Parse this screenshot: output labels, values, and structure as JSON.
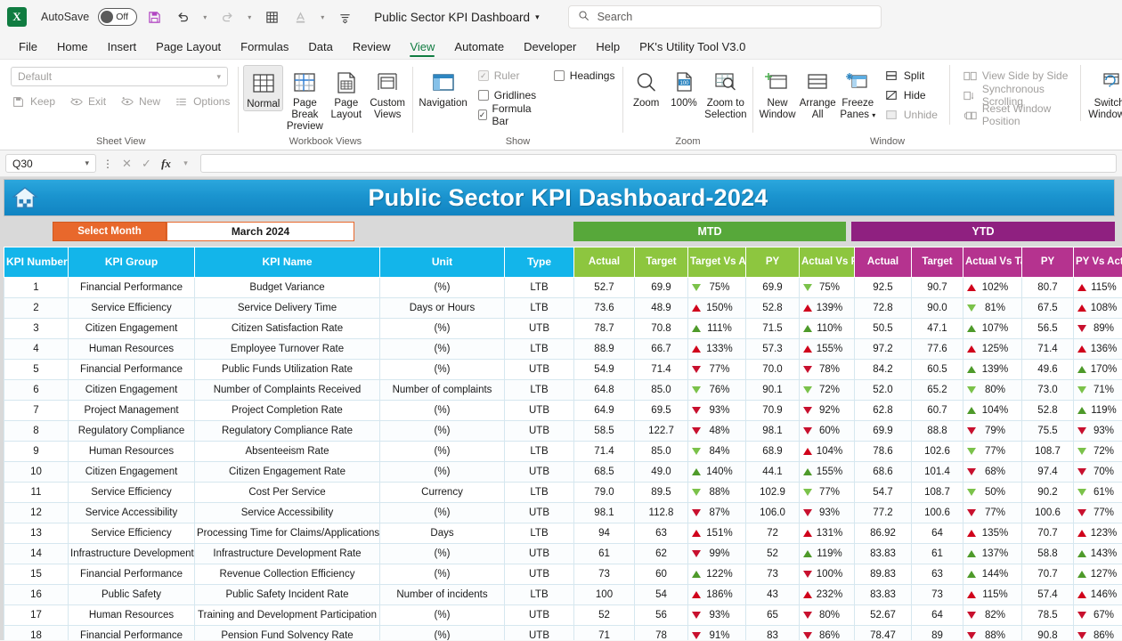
{
  "titlebar": {
    "autosave_label": "AutoSave",
    "autosave_state": "Off",
    "doc_title": "Public Sector KPI Dashboard",
    "search_placeholder": "Search",
    "xl_logo_letter": "X"
  },
  "tabs": [
    {
      "label": "File",
      "active": false
    },
    {
      "label": "Home",
      "active": false
    },
    {
      "label": "Insert",
      "active": false
    },
    {
      "label": "Page Layout",
      "active": false
    },
    {
      "label": "Formulas",
      "active": false
    },
    {
      "label": "Data",
      "active": false
    },
    {
      "label": "Review",
      "active": false
    },
    {
      "label": "View",
      "active": true
    },
    {
      "label": "Automate",
      "active": false
    },
    {
      "label": "Developer",
      "active": false
    },
    {
      "label": "Help",
      "active": false
    },
    {
      "label": "PK's Utility Tool V3.0",
      "active": false
    }
  ],
  "ribbon": {
    "groups": [
      {
        "name": "Sheet View",
        "combo_value": "Default",
        "buttons": [
          "Keep",
          "Exit",
          "New",
          "Options"
        ]
      },
      {
        "name": "Workbook Views",
        "buttons": [
          "Normal",
          "Page Break Preview",
          "Page Layout",
          "Custom Views"
        ]
      },
      {
        "name": "Show",
        "navigation": "Navigation",
        "checks": [
          {
            "label": "Ruler",
            "checked": true,
            "disabled": true
          },
          {
            "label": "Gridlines",
            "checked": false,
            "disabled": false
          },
          {
            "label": "Formula Bar",
            "checked": true,
            "disabled": false
          },
          {
            "label": "Headings",
            "checked": false,
            "disabled": false
          }
        ]
      },
      {
        "name": "Zoom",
        "buttons": [
          "Zoom",
          "100%",
          "Zoom to Selection"
        ]
      },
      {
        "name": "Window",
        "buttons": [
          "New Window",
          "Arrange All",
          "Freeze Panes"
        ],
        "small": [
          "Split",
          "Hide",
          "Unhide"
        ],
        "small2": [
          "View Side by Side",
          "Synchronous Scrolling",
          "Reset Window Position"
        ],
        "switch": "Switch Windows"
      }
    ]
  },
  "formula_bar": {
    "name_box": "Q30",
    "formula_value": "",
    "cancel_icon": "cancel-icon",
    "enter_icon": "enter-icon",
    "fx_icon": "fx-icon"
  },
  "dashboard": {
    "title": "Public Sector KPI Dashboard-2024",
    "home_icon": "home-icon",
    "select_month_label": "Select Month",
    "selected_month": "March 2024",
    "period_mtd": "MTD",
    "period_ytd": "YTD",
    "colors": {
      "banner": "#1b94cf",
      "select_month": "#e8682c",
      "mtd": "#57a83a",
      "mtd_header": "#8dc63f",
      "ytd": "#8f2080",
      "ytd_header": "#b5338f",
      "left_header": "#13b5ea",
      "up_red": "#d0021b",
      "down_red": "#c8102e",
      "up_green": "#4e9a2a",
      "down_green": "#7bc24a"
    },
    "columns_left": [
      "KPI Number",
      "KPI Group",
      "KPI Name",
      "Unit",
      "Type"
    ],
    "columns_mtd": [
      "Actual",
      "Target",
      "Target Vs Actual",
      "PY",
      "Actual Vs PY"
    ],
    "columns_ytd": [
      "Actual",
      "Target",
      "Actual Vs Target",
      "PY",
      "PY Vs Actual"
    ],
    "rows": [
      {
        "n": "1",
        "group": "Financial Performance",
        "name": "Budget Variance",
        "unit": "(%)",
        "type": "LTB",
        "mtd": {
          "actual": "52.7",
          "target": "69.9",
          "tva": "75%",
          "tva_dir": "down",
          "tva_color": "down_green",
          "py": "69.9",
          "avp": "75%",
          "avp_dir": "down",
          "avp_color": "down_green"
        },
        "ytd": {
          "actual": "92.5",
          "target": "90.7",
          "avt": "102%",
          "avt_dir": "up",
          "avt_color": "up_red",
          "py": "80.7",
          "pva": "115%",
          "pva_dir": "up",
          "pva_color": "up_red"
        }
      },
      {
        "n": "2",
        "group": "Service Efficiency",
        "name": "Service Delivery Time",
        "unit": "Days or Hours",
        "type": "LTB",
        "mtd": {
          "actual": "73.6",
          "target": "48.9",
          "tva": "150%",
          "tva_dir": "up",
          "tva_color": "up_red",
          "py": "52.8",
          "avp": "139%",
          "avp_dir": "up",
          "avp_color": "up_red"
        },
        "ytd": {
          "actual": "72.8",
          "target": "90.0",
          "avt": "81%",
          "avt_dir": "down",
          "avt_color": "down_green",
          "py": "67.5",
          "pva": "108%",
          "pva_dir": "up",
          "pva_color": "up_red"
        }
      },
      {
        "n": "3",
        "group": "Citizen Engagement",
        "name": "Citizen Satisfaction Rate",
        "unit": "(%)",
        "type": "UTB",
        "mtd": {
          "actual": "78.7",
          "target": "70.8",
          "tva": "111%",
          "tva_dir": "up",
          "tva_color": "up_green",
          "py": "71.5",
          "avp": "110%",
          "avp_dir": "up",
          "avp_color": "up_green"
        },
        "ytd": {
          "actual": "50.5",
          "target": "47.1",
          "avt": "107%",
          "avt_dir": "up",
          "avt_color": "up_green",
          "py": "56.5",
          "pva": "89%",
          "pva_dir": "down",
          "pva_color": "down_red"
        }
      },
      {
        "n": "4",
        "group": "Human Resources",
        "name": "Employee Turnover Rate",
        "unit": "(%)",
        "type": "LTB",
        "mtd": {
          "actual": "88.9",
          "target": "66.7",
          "tva": "133%",
          "tva_dir": "up",
          "tva_color": "up_red",
          "py": "57.3",
          "avp": "155%",
          "avp_dir": "up",
          "avp_color": "up_red"
        },
        "ytd": {
          "actual": "97.2",
          "target": "77.6",
          "avt": "125%",
          "avt_dir": "up",
          "avt_color": "up_red",
          "py": "71.4",
          "pva": "136%",
          "pva_dir": "up",
          "pva_color": "up_red"
        }
      },
      {
        "n": "5",
        "group": "Financial Performance",
        "name": "Public Funds Utilization Rate",
        "unit": "(%)",
        "type": "UTB",
        "mtd": {
          "actual": "54.9",
          "target": "71.4",
          "tva": "77%",
          "tva_dir": "down",
          "tva_color": "down_red",
          "py": "70.0",
          "avp": "78%",
          "avp_dir": "down",
          "avp_color": "down_red"
        },
        "ytd": {
          "actual": "84.2",
          "target": "60.5",
          "avt": "139%",
          "avt_dir": "up",
          "avt_color": "up_green",
          "py": "49.6",
          "pva": "170%",
          "pva_dir": "up",
          "pva_color": "up_green"
        }
      },
      {
        "n": "6",
        "group": "Citizen Engagement",
        "name": "Number of Complaints Received",
        "unit": "Number of complaints",
        "type": "LTB",
        "mtd": {
          "actual": "64.8",
          "target": "85.0",
          "tva": "76%",
          "tva_dir": "down",
          "tva_color": "down_green",
          "py": "90.1",
          "avp": "72%",
          "avp_dir": "down",
          "avp_color": "down_green"
        },
        "ytd": {
          "actual": "52.0",
          "target": "65.2",
          "avt": "80%",
          "avt_dir": "down",
          "avt_color": "down_green",
          "py": "73.0",
          "pva": "71%",
          "pva_dir": "down",
          "pva_color": "down_green"
        }
      },
      {
        "n": "7",
        "group": "Project Management",
        "name": "Project Completion Rate",
        "unit": "(%)",
        "type": "UTB",
        "mtd": {
          "actual": "64.9",
          "target": "69.5",
          "tva": "93%",
          "tva_dir": "down",
          "tva_color": "down_red",
          "py": "70.9",
          "avp": "92%",
          "avp_dir": "down",
          "avp_color": "down_red"
        },
        "ytd": {
          "actual": "62.8",
          "target": "60.7",
          "avt": "104%",
          "avt_dir": "up",
          "avt_color": "up_green",
          "py": "52.8",
          "pva": "119%",
          "pva_dir": "up",
          "pva_color": "up_green"
        }
      },
      {
        "n": "8",
        "group": "Regulatory Compliance",
        "name": "Regulatory Compliance Rate",
        "unit": "(%)",
        "type": "UTB",
        "mtd": {
          "actual": "58.5",
          "target": "122.7",
          "tva": "48%",
          "tva_dir": "down",
          "tva_color": "down_red",
          "py": "98.1",
          "avp": "60%",
          "avp_dir": "down",
          "avp_color": "down_red"
        },
        "ytd": {
          "actual": "69.9",
          "target": "88.8",
          "avt": "79%",
          "avt_dir": "down",
          "avt_color": "down_red",
          "py": "75.5",
          "pva": "93%",
          "pva_dir": "down",
          "pva_color": "down_red"
        }
      },
      {
        "n": "9",
        "group": "Human Resources",
        "name": "Absenteeism Rate",
        "unit": "(%)",
        "type": "LTB",
        "mtd": {
          "actual": "71.4",
          "target": "85.0",
          "tva": "84%",
          "tva_dir": "down",
          "tva_color": "down_green",
          "py": "68.9",
          "avp": "104%",
          "avp_dir": "up",
          "avp_color": "up_red"
        },
        "ytd": {
          "actual": "78.6",
          "target": "102.6",
          "avt": "77%",
          "avt_dir": "down",
          "avt_color": "down_green",
          "py": "108.7",
          "pva": "72%",
          "pva_dir": "down",
          "pva_color": "down_green"
        }
      },
      {
        "n": "10",
        "group": "Citizen Engagement",
        "name": "Citizen Engagement Rate",
        "unit": "(%)",
        "type": "UTB",
        "mtd": {
          "actual": "68.5",
          "target": "49.0",
          "tva": "140%",
          "tva_dir": "up",
          "tva_color": "up_green",
          "py": "44.1",
          "avp": "155%",
          "avp_dir": "up",
          "avp_color": "up_green"
        },
        "ytd": {
          "actual": "68.6",
          "target": "101.4",
          "avt": "68%",
          "avt_dir": "down",
          "avt_color": "down_red",
          "py": "97.4",
          "pva": "70%",
          "pva_dir": "down",
          "pva_color": "down_red"
        }
      },
      {
        "n": "11",
        "group": "Service Efficiency",
        "name": "Cost Per Service",
        "unit": "Currency",
        "type": "LTB",
        "mtd": {
          "actual": "79.0",
          "target": "89.5",
          "tva": "88%",
          "tva_dir": "down",
          "tva_color": "down_green",
          "py": "102.9",
          "avp": "77%",
          "avp_dir": "down",
          "avp_color": "down_green"
        },
        "ytd": {
          "actual": "54.7",
          "target": "108.7",
          "avt": "50%",
          "avt_dir": "down",
          "avt_color": "down_green",
          "py": "90.2",
          "pva": "61%",
          "pva_dir": "down",
          "pva_color": "down_green"
        }
      },
      {
        "n": "12",
        "group": "Service Accessibility",
        "name": "Service Accessibility",
        "unit": "(%)",
        "type": "UTB",
        "mtd": {
          "actual": "98.1",
          "target": "112.8",
          "tva": "87%",
          "tva_dir": "down",
          "tva_color": "down_red",
          "py": "106.0",
          "avp": "93%",
          "avp_dir": "down",
          "avp_color": "down_red"
        },
        "ytd": {
          "actual": "77.2",
          "target": "100.6",
          "avt": "77%",
          "avt_dir": "down",
          "avt_color": "down_red",
          "py": "100.6",
          "pva": "77%",
          "pva_dir": "down",
          "pva_color": "down_red"
        }
      },
      {
        "n": "13",
        "group": "Service Efficiency",
        "name": "Processing Time for Claims/Applications",
        "unit": "Days",
        "type": "LTB",
        "mtd": {
          "actual": "94",
          "target": "63",
          "tva": "151%",
          "tva_dir": "up",
          "tva_color": "up_red",
          "py": "72",
          "avp": "131%",
          "avp_dir": "up",
          "avp_color": "up_red"
        },
        "ytd": {
          "actual": "86.92",
          "target": "64",
          "avt": "135%",
          "avt_dir": "up",
          "avt_color": "up_red",
          "py": "70.7",
          "pva": "123%",
          "pva_dir": "up",
          "pva_color": "up_red"
        }
      },
      {
        "n": "14",
        "group": "Infrastructure Development",
        "name": "Infrastructure Development Rate",
        "unit": "(%)",
        "type": "UTB",
        "mtd": {
          "actual": "61",
          "target": "62",
          "tva": "99%",
          "tva_dir": "down",
          "tva_color": "down_red",
          "py": "52",
          "avp": "119%",
          "avp_dir": "up",
          "avp_color": "up_green"
        },
        "ytd": {
          "actual": "83.83",
          "target": "61",
          "avt": "137%",
          "avt_dir": "up",
          "avt_color": "up_green",
          "py": "58.8",
          "pva": "143%",
          "pva_dir": "up",
          "pva_color": "up_green"
        }
      },
      {
        "n": "15",
        "group": "Financial Performance",
        "name": "Revenue Collection Efficiency",
        "unit": "(%)",
        "type": "UTB",
        "mtd": {
          "actual": "73",
          "target": "60",
          "tva": "122%",
          "tva_dir": "up",
          "tva_color": "up_green",
          "py": "73",
          "avp": "100%",
          "avp_dir": "down",
          "avp_color": "down_red"
        },
        "ytd": {
          "actual": "89.83",
          "target": "63",
          "avt": "144%",
          "avt_dir": "up",
          "avt_color": "up_green",
          "py": "70.7",
          "pva": "127%",
          "pva_dir": "up",
          "pva_color": "up_green"
        }
      },
      {
        "n": "16",
        "group": "Public Safety",
        "name": "Public Safety Incident Rate",
        "unit": "Number of incidents",
        "type": "LTB",
        "mtd": {
          "actual": "100",
          "target": "54",
          "tva": "186%",
          "tva_dir": "up",
          "tva_color": "up_red",
          "py": "43",
          "avp": "232%",
          "avp_dir": "up",
          "avp_color": "up_red"
        },
        "ytd": {
          "actual": "83.83",
          "target": "73",
          "avt": "115%",
          "avt_dir": "up",
          "avt_color": "up_red",
          "py": "57.4",
          "pva": "146%",
          "pva_dir": "up",
          "pva_color": "up_red"
        }
      },
      {
        "n": "17",
        "group": "Human Resources",
        "name": "Training and Development Participation",
        "unit": "(%)",
        "type": "UTB",
        "mtd": {
          "actual": "52",
          "target": "56",
          "tva": "93%",
          "tva_dir": "down",
          "tva_color": "down_red",
          "py": "65",
          "avp": "80%",
          "avp_dir": "down",
          "avp_color": "down_red"
        },
        "ytd": {
          "actual": "52.67",
          "target": "64",
          "avt": "82%",
          "avt_dir": "down",
          "avt_color": "down_red",
          "py": "78.5",
          "pva": "67%",
          "pva_dir": "down",
          "pva_color": "down_red"
        }
      },
      {
        "n": "18",
        "group": "Financial Performance",
        "name": "Pension Fund Solvency Rate",
        "unit": "(%)",
        "type": "UTB",
        "mtd": {
          "actual": "71",
          "target": "78",
          "tva": "91%",
          "tva_dir": "down",
          "tva_color": "down_red",
          "py": "83",
          "avp": "86%",
          "avp_dir": "down",
          "avp_color": "down_red"
        },
        "ytd": {
          "actual": "78.47",
          "target": "89",
          "avt": "88%",
          "avt_dir": "down",
          "avt_color": "down_red",
          "py": "90.8",
          "pva": "86%",
          "pva_dir": "down",
          "pva_color": "down_red"
        }
      }
    ]
  }
}
